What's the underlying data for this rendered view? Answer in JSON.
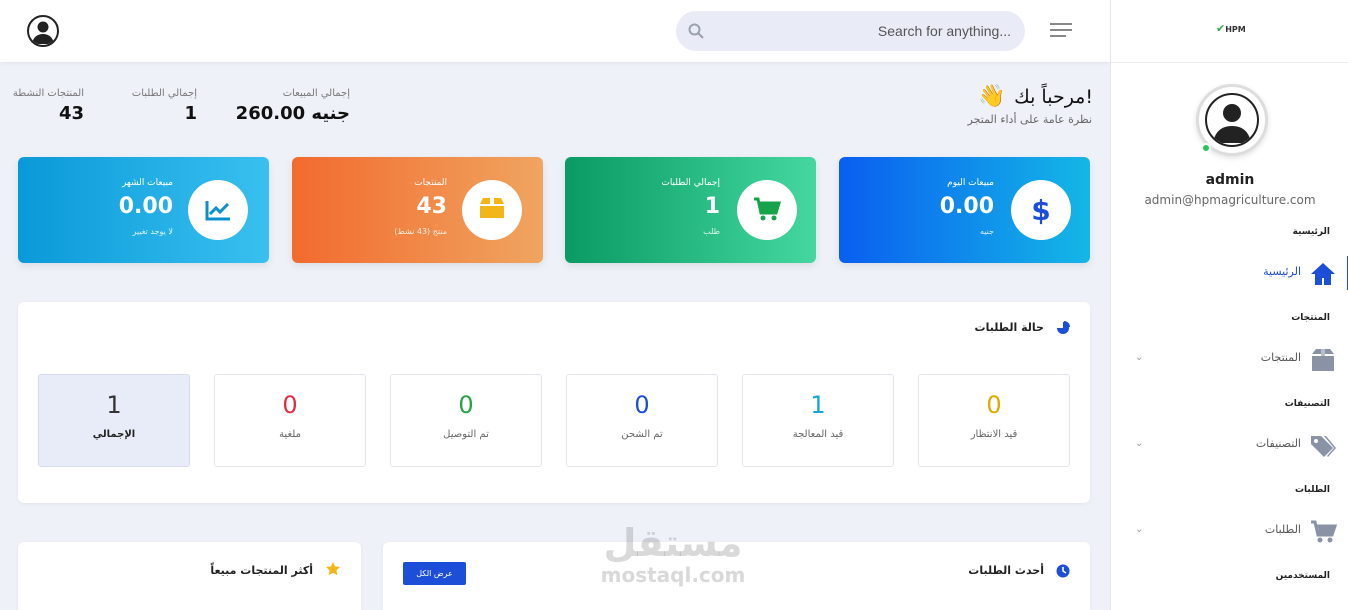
{
  "header": {
    "search_placeholder": "Search for anything..."
  },
  "sidebar": {
    "logo_text": "HPM",
    "user_name": "admin",
    "user_email": "admin@hpmagriculture.com",
    "sections": [
      {
        "title": "الرئيسية",
        "item": "الرئيسية",
        "icon": "home-icon",
        "active": true
      },
      {
        "title": "المنتجات",
        "item": "المنتجات",
        "icon": "box-icon",
        "active": false
      },
      {
        "title": "التصنيفات",
        "item": "التصنيفات",
        "icon": "tags-icon",
        "active": false
      },
      {
        "title": "الطلبات",
        "item": "الطلبات",
        "icon": "cart-icon",
        "active": false
      },
      {
        "title": "المستخدمين"
      }
    ]
  },
  "welcome": {
    "title": "مرحباً بك!",
    "subtitle": "نظرة عامة على أداء المتجر"
  },
  "stats": [
    {
      "label": "إجمالي المبيعات",
      "value": "260.00 جنيه"
    },
    {
      "label": "إجمالي الطلبات",
      "value": "1"
    },
    {
      "label": "المنتجات النشطة",
      "value": "43"
    }
  ],
  "cards": [
    {
      "title": "مبيعات اليوم",
      "value": "0.00",
      "sub": "جنيه",
      "icon": "dollar-icon"
    },
    {
      "title": "إجمالي الطلبات",
      "value": "1",
      "sub": "طلب",
      "icon": "cart-icon"
    },
    {
      "title": "المنتجات",
      "value": "43",
      "sub": "منتج (43 نشط)",
      "icon": "box-icon"
    },
    {
      "title": "مبيعات الشهر",
      "value": "0.00",
      "sub": "لا يوجد تغيير",
      "icon": "chart-line-icon"
    }
  ],
  "order_status": {
    "title": "حالة الطلبات",
    "items": [
      {
        "label": "قيد الانتظار",
        "value": "0",
        "color": "#e0a800"
      },
      {
        "label": "قيد المعالجة",
        "value": "1",
        "color": "#17a2d8"
      },
      {
        "label": "تم الشحن",
        "value": "0",
        "color": "#1d4ed8"
      },
      {
        "label": "تم التوصيل",
        "value": "0",
        "color": "#22a447"
      },
      {
        "label": "ملغية",
        "value": "0",
        "color": "#dc2f45"
      },
      {
        "label": "الإجمالي",
        "value": "1",
        "color": "#333333"
      }
    ]
  },
  "recent_orders": {
    "title": "أحدث الطلبات",
    "view_all": "عرض الكل"
  },
  "top_products": {
    "title": "أكثر المنتجات مبيعاً"
  },
  "watermark": {
    "arabic": "مستقل",
    "latin": "mostaql.com"
  }
}
